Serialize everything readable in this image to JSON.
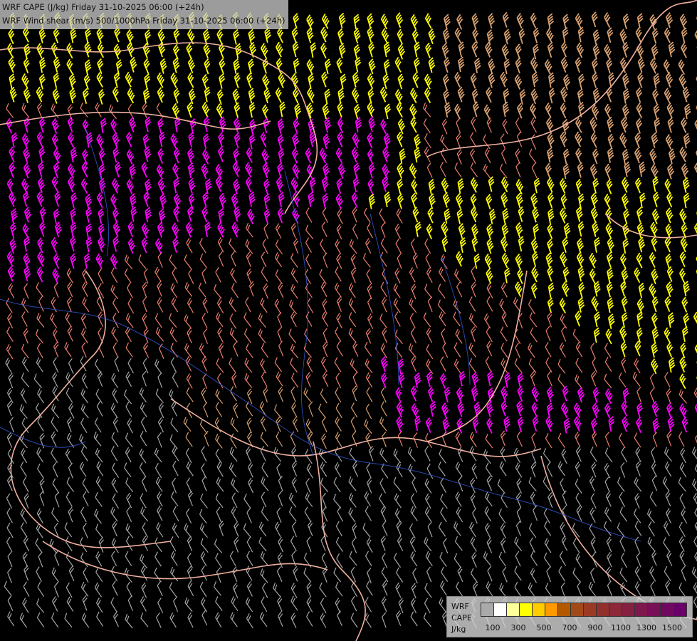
{
  "header": {
    "line1": "WRF CAPE (J/kg) Friday 31-10-2025 06:00 (+24h)",
    "line2": "WRF Wind shear (m/s) 500/1000hPa Friday 31-10-2025 06:00 (+24h)"
  },
  "legend": {
    "label1": "WRF",
    "label2": "CAPE",
    "label3": "J/kg",
    "swatch_colors": [
      "#aaaaaa",
      "#ffffff",
      "#ffff99",
      "#ffff00",
      "#ffcc00",
      "#ff9900",
      "#b35900",
      "#a04a1a",
      "#9a3a25",
      "#93302e",
      "#8c2838",
      "#852042",
      "#7e184c",
      "#771056",
      "#700860",
      "#69006a"
    ],
    "ticks": [
      "100",
      "300",
      "500",
      "700",
      "900",
      "1100",
      "1300",
      "1500"
    ]
  },
  "colors": {
    "background": "#000000",
    "border": "#f0b0a0",
    "river": "#3355cc",
    "barb_yellow": "#ffff00",
    "barb_magenta": "#ff00ff",
    "barb_salmon": "#f08070",
    "barb_tan": "#d8a070",
    "barb_gray": "#a8a8a8"
  }
}
